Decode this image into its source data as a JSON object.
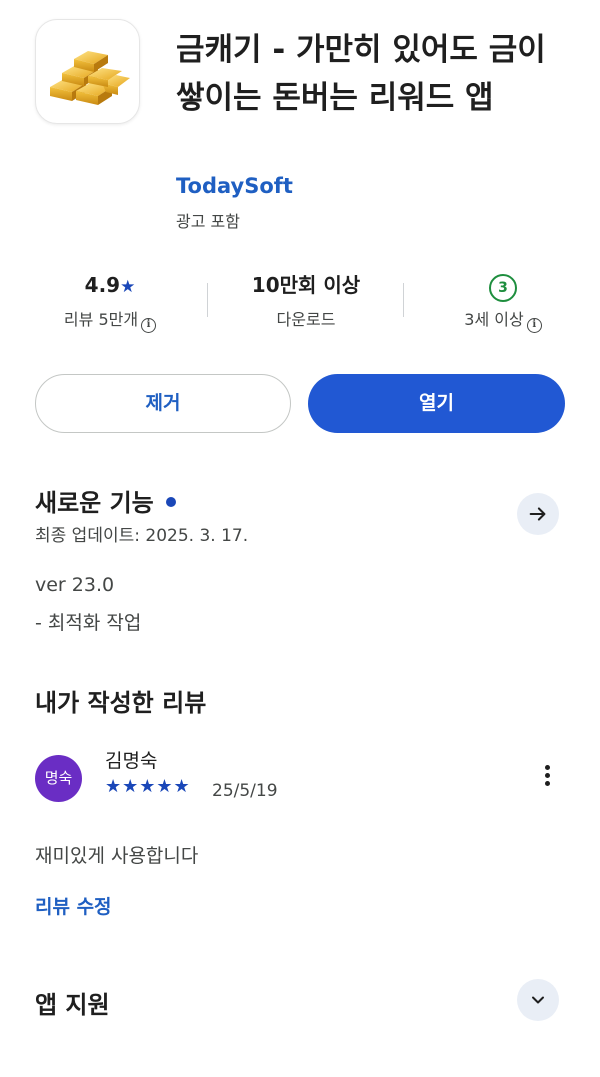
{
  "app": {
    "title": "금캐기 - 가만히 있어도 금이 쌓이는 돈버는 리워드 앱",
    "developer": "TodaySoft",
    "ad_label": "광고 포함",
    "icon": "gold-bars-icon"
  },
  "stats": {
    "rating": {
      "value": "4.9",
      "star": "★",
      "label": "리뷰 5만개"
    },
    "downloads": {
      "value": "10만회 이상",
      "label": "다운로드"
    },
    "age": {
      "badge": "3",
      "label": "3세 이상"
    }
  },
  "actions": {
    "uninstall": "제거",
    "open": "열기"
  },
  "whats_new": {
    "title": "새로운 기능",
    "updated": "최종 업데이트: 2025. 3. 17.",
    "version": "ver 23.0",
    "note": "- 최적화 작업"
  },
  "my_review": {
    "title": "내가 작성한 리뷰",
    "avatar_text": "명숙",
    "reviewer": "김명숙",
    "rating": 5,
    "stars": "★★★★★",
    "date": "25/5/19",
    "text": "재미있게 사용합니다",
    "edit_link": "리뷰 수정"
  },
  "app_support": {
    "title": "앱 지원"
  },
  "colors": {
    "accent_blue": "#2158d3",
    "link_blue": "#1f5fc2",
    "age_green": "#1e8e3e",
    "avatar_purple": "#6a2dc4"
  }
}
